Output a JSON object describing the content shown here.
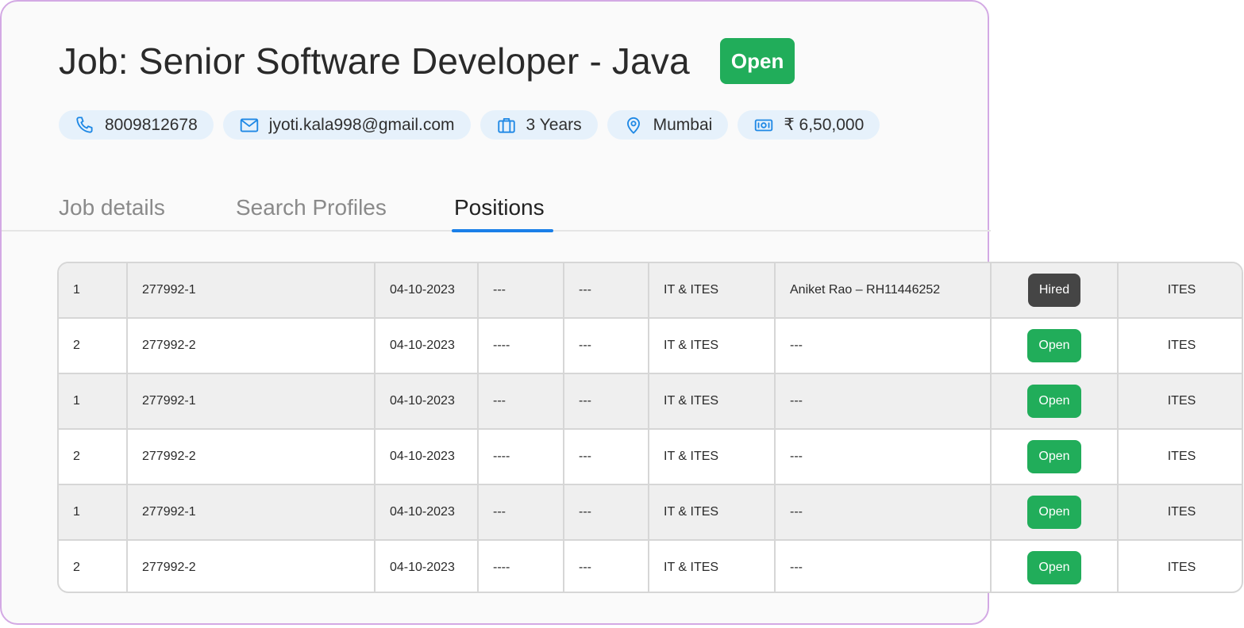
{
  "job": {
    "title": "Job: Senior Software Developer - Java",
    "status": "Open",
    "status_color": "#21ad5a"
  },
  "chips": {
    "phone": {
      "icon": "phone-icon",
      "text": "8009812678"
    },
    "email": {
      "icon": "mail-icon",
      "text": "jyoti.kala998@gmail.com"
    },
    "experience": {
      "icon": "briefcase-icon",
      "text": "3 Years"
    },
    "location": {
      "icon": "location-pin-icon",
      "text": "Mumbai"
    },
    "salary": {
      "icon": "money-icon",
      "text": "₹ 6,50,000"
    }
  },
  "tabs": [
    {
      "label": "Job details",
      "active": false
    },
    {
      "label": "Search Profiles",
      "active": false
    },
    {
      "label": "Positions",
      "active": true
    }
  ],
  "accent_color": "#1a7fe8",
  "positions": [
    {
      "no": "1",
      "id": "277992-1",
      "date": "04-10-2023",
      "c4": "---",
      "c5": "---",
      "industry": "IT & ITES",
      "candidate": "Aniket Rao – RH11446252",
      "status": "Hired",
      "type": "ITES"
    },
    {
      "no": "2",
      "id": "277992-2",
      "date": "04-10-2023",
      "c4": "----",
      "c5": "---",
      "industry": "IT & ITES",
      "candidate": "---",
      "status": "Open",
      "type": "ITES"
    },
    {
      "no": "1",
      "id": "277992-1",
      "date": "04-10-2023",
      "c4": "---",
      "c5": "---",
      "industry": "IT & ITES",
      "candidate": "---",
      "status": "Open",
      "type": "ITES"
    },
    {
      "no": "2",
      "id": "277992-2",
      "date": "04-10-2023",
      "c4": "----",
      "c5": "---",
      "industry": "IT & ITES",
      "candidate": "---",
      "status": "Open",
      "type": "ITES"
    },
    {
      "no": "1",
      "id": "277992-1",
      "date": "04-10-2023",
      "c4": "---",
      "c5": "---",
      "industry": "IT & ITES",
      "candidate": "---",
      "status": "Open",
      "type": "ITES"
    },
    {
      "no": "2",
      "id": "277992-2",
      "date": "04-10-2023",
      "c4": "----",
      "c5": "---",
      "industry": "IT & ITES",
      "candidate": "---",
      "status": "Open",
      "type": "ITES"
    }
  ]
}
